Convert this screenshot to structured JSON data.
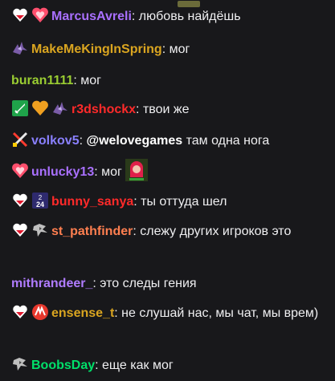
{
  "chat": {
    "messages": [
      {
        "badges": [
          "heart-badge",
          "pink-heart-badge"
        ],
        "user": "MarcusAvreli",
        "color": "#a970ff",
        "text": "любовь найдёшь"
      },
      {
        "badges": [
          "bat-badge"
        ],
        "user": "MakeMeKingInSpring",
        "color": "#daa520",
        "text": "мог"
      },
      {
        "badges": [],
        "user": "buran1111",
        "color": "#9acd32",
        "text": "мог"
      },
      {
        "badges": [
          "green-sword-badge",
          "gold-heart-badge",
          "bat-badge"
        ],
        "user": "r3dshockx",
        "color": "#ff2a2a",
        "text": "твои же"
      },
      {
        "badges": [
          "swords-badge"
        ],
        "user": "volkov5",
        "color": "#8a80ff",
        "mention": "@welovegames",
        "text": "там одна нога"
      },
      {
        "badges": [
          "pink-heart-badge"
        ],
        "user": "unlucky13",
        "color": "#a970ff",
        "text": "мог",
        "emote": "girl-emote"
      },
      {
        "badges": [
          "heart-badge",
          "24-badge"
        ],
        "user": "bunny_sanya",
        "color": "#ff2a2a",
        "text": "ты оттуда шел"
      },
      {
        "badges": [
          "heart-badge",
          "dragon-badge"
        ],
        "user": "st_pathfinder",
        "color": "#ff7f50",
        "text": "слежу других игроков это"
      },
      {
        "badges": [],
        "user": "mithrandeer_",
        "color": "#b07cff",
        "text": "это следы гения"
      },
      {
        "badges": [
          "heart-badge",
          "red-shield-badge"
        ],
        "user": "ensense_t",
        "color": "#daa520",
        "text": "не слушай нас, мы чат, мы врем)"
      },
      {
        "badges": [
          "dragon-badge"
        ],
        "user": "BoobsDay",
        "color": "#00e06a",
        "text": "еще как мог"
      }
    ]
  },
  "colors": {
    "background": "#18181b",
    "text": "#efeff1",
    "heart": "#ffffff",
    "pink": "#ff4f6d",
    "gold": "#f0a020"
  }
}
